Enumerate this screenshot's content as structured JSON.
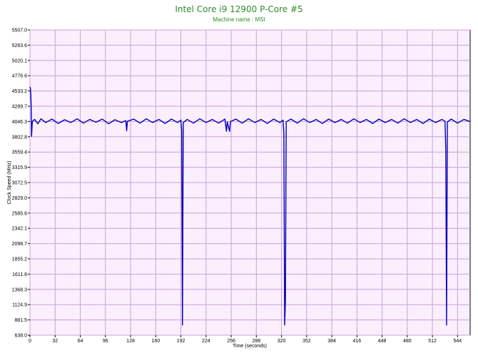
{
  "chart_data": {
    "type": "line",
    "title": "Intel Core i9  12900 P-Core #5",
    "subtitle": "Machine name : MSI",
    "xlabel": "Time (seconds)",
    "ylabel": "Clock Speed (MHz)",
    "xlim": [
      0,
      560
    ],
    "ylim": [
      638.0,
      5507.0
    ],
    "x_ticks": [
      0,
      32,
      64,
      96,
      128,
      160,
      192,
      224,
      256,
      288,
      320,
      352,
      384,
      416,
      448,
      480,
      512,
      544
    ],
    "y_ticks": [
      "638.0",
      "881.5",
      "1124.9",
      "1368.3",
      "1611.8",
      "1855.2",
      "2098.7",
      "2342.1",
      "2585.6",
      "2829.0",
      "3072.5",
      "3315.9",
      "3559.4",
      "3802.8",
      "4046.3",
      "4289.7",
      "4533.2",
      "4776.6",
      "5020.1",
      "5263.6",
      "5507.0"
    ],
    "grid": true,
    "colors": {
      "line": "#0000bb",
      "plot_bg": "#fbeefd",
      "grid": "#c8a2d8",
      "title": "#2e8b2e"
    },
    "series": [
      {
        "values": [
          [
            0,
            4600
          ],
          [
            0.5,
            4580
          ],
          [
            1,
            4500
          ],
          [
            1.5,
            4300
          ],
          [
            2,
            3810
          ],
          [
            3,
            4046
          ],
          [
            6,
            4080
          ],
          [
            10,
            4010
          ],
          [
            14,
            4090
          ],
          [
            20,
            4030
          ],
          [
            28,
            4085
          ],
          [
            36,
            4015
          ],
          [
            44,
            4075
          ],
          [
            52,
            4030
          ],
          [
            60,
            4090
          ],
          [
            68,
            4020
          ],
          [
            76,
            4080
          ],
          [
            84,
            4035
          ],
          [
            92,
            4085
          ],
          [
            100,
            4010
          ],
          [
            108,
            4075
          ],
          [
            116,
            4030
          ],
          [
            122,
            4060
          ],
          [
            123,
            3900
          ],
          [
            124,
            4050
          ],
          [
            132,
            4085
          ],
          [
            140,
            4020
          ],
          [
            148,
            4090
          ],
          [
            156,
            4030
          ],
          [
            164,
            4080
          ],
          [
            172,
            4015
          ],
          [
            180,
            4085
          ],
          [
            188,
            4030
          ],
          [
            192,
            4070
          ],
          [
            193,
            3900
          ],
          [
            194,
            800
          ],
          [
            195,
            4030
          ],
          [
            200,
            4080
          ],
          [
            208,
            4020
          ],
          [
            216,
            4090
          ],
          [
            224,
            4030
          ],
          [
            232,
            4080
          ],
          [
            240,
            4020
          ],
          [
            248,
            4085
          ],
          [
            250,
            3890
          ],
          [
            251,
            4040
          ],
          [
            254,
            3890
          ],
          [
            255,
            4045
          ],
          [
            262,
            4085
          ],
          [
            270,
            4020
          ],
          [
            278,
            4090
          ],
          [
            286,
            4030
          ],
          [
            294,
            4080
          ],
          [
            302,
            4015
          ],
          [
            310,
            4085
          ],
          [
            318,
            4030
          ],
          [
            322,
            4070
          ],
          [
            323,
            3850
          ],
          [
            324,
            800
          ],
          [
            325,
            1200
          ],
          [
            326,
            4040
          ],
          [
            332,
            4085
          ],
          [
            340,
            4020
          ],
          [
            348,
            4090
          ],
          [
            356,
            4030
          ],
          [
            364,
            4080
          ],
          [
            372,
            4015
          ],
          [
            380,
            4085
          ],
          [
            388,
            4030
          ],
          [
            396,
            4080
          ],
          [
            404,
            4020
          ],
          [
            412,
            4090
          ],
          [
            420,
            4030
          ],
          [
            428,
            4080
          ],
          [
            436,
            4015
          ],
          [
            444,
            4085
          ],
          [
            452,
            4030
          ],
          [
            460,
            4080
          ],
          [
            468,
            4020
          ],
          [
            476,
            4090
          ],
          [
            484,
            4030
          ],
          [
            492,
            4080
          ],
          [
            500,
            4015
          ],
          [
            508,
            4085
          ],
          [
            516,
            4030
          ],
          [
            524,
            4080
          ],
          [
            528,
            4050
          ],
          [
            529,
            3600
          ],
          [
            530,
            800
          ],
          [
            531,
            4040
          ],
          [
            536,
            4085
          ],
          [
            544,
            4020
          ],
          [
            552,
            4080
          ],
          [
            560,
            4046
          ]
        ]
      }
    ]
  }
}
